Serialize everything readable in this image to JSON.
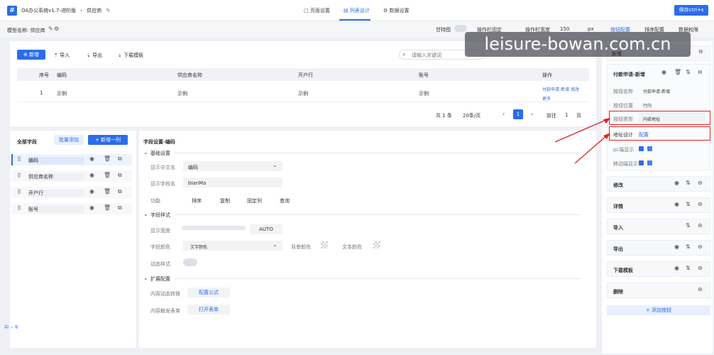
{
  "header": {
    "logo": "#",
    "breadcrumb": [
      "OA办公系统v1.7-进阶版",
      "供应商"
    ],
    "tabs": [
      {
        "label": "页面设置"
      },
      {
        "label": "列表设计"
      },
      {
        "label": "数据设置"
      }
    ],
    "save_label": "保存ctrl+s"
  },
  "subbar": {
    "model_name": "模型名称: 供应商",
    "gantt": "甘特图",
    "fixed": "操作栏固定",
    "width": "操作栏宽度",
    "width_val": "150",
    "px": "px",
    "tabs": [
      "按钮配置",
      "排序配置",
      "数据权限"
    ]
  },
  "list": {
    "add": "新增",
    "import": "导入",
    "export": "导出",
    "download": "下载模板",
    "search_placeholder": "请输入关键词",
    "columns": [
      "序号",
      "编码",
      "供应商名称",
      "开户行",
      "账号",
      "操作"
    ],
    "rows": [
      {
        "no": "1",
        "code": "示例",
        "name": "示例",
        "bank": "示例",
        "acct": "示例",
        "ops": "付款申请-新增  修改",
        "more": "更多"
      }
    ],
    "pager": {
      "total": "共 1 条",
      "size": "20条/页",
      "page": "1",
      "goto": "前往",
      "goto_val": "1",
      "unit": "页"
    }
  },
  "fields": {
    "title": "全部字段",
    "batch": "批量添加",
    "new_col": "+ 新增一列",
    "items": [
      "编码",
      "供应商名称",
      "开户行",
      "账号"
    ]
  },
  "settings": {
    "title": "字段设置-编码",
    "basic": "基础设置",
    "display_name_label": "显示中文名",
    "display_name_val": "编码",
    "field_label": "显示字段名",
    "field_val": "bianMa",
    "func_label": "功能",
    "funcs": [
      "排序",
      "复制",
      "固定列",
      "查询"
    ],
    "style": "字段样式",
    "width_label": "显示宽度",
    "width_val": "AUTO",
    "color_label": "字段颜色",
    "color_val": "文字颜色",
    "bg_label": "背景颜色",
    "text_color_label": "文本颜色",
    "dynamic_label": "动态样式",
    "ext": "扩展配置",
    "conv_label": "内容动态转换",
    "conv_btn": "配置公式",
    "trigger_label": "内容触发表单",
    "trigger_btn": "打开表单"
  },
  "buttons": {
    "first": "新增",
    "active_title": "付款申请-新增",
    "name_label": "按钮名称",
    "name_val": "付款申请-新增",
    "pos_label": "按钮位置",
    "pos_val": "行内",
    "type_label": "按钮类型",
    "type_val": "内嵌地址",
    "addr_label": "地址设计",
    "addr_val": "配置",
    "pc_label": "pc端显示",
    "mobile_label": "移动端显示",
    "items": [
      "修改",
      "详情",
      "导入",
      "导出",
      "下载模板",
      "删除"
    ],
    "add_btn": "+ 添加按钮"
  },
  "watermark": "leisure-bowan.com.cn",
  "footer_tools": "中 ·› 半"
}
